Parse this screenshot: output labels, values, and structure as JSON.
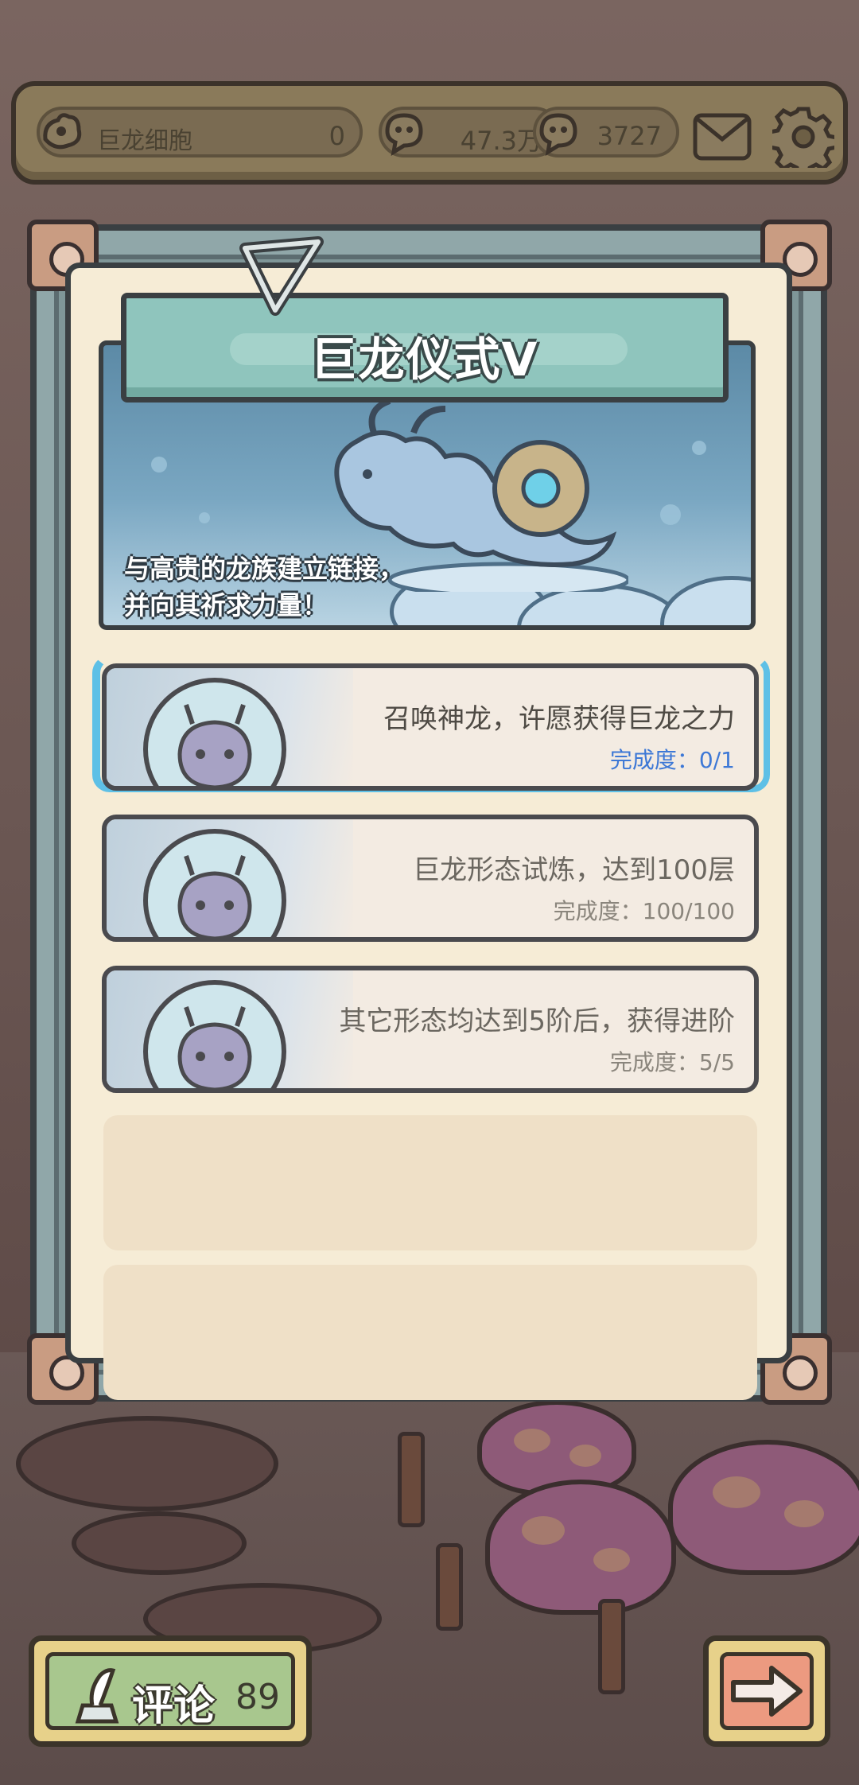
{
  "resources": [
    {
      "icon": "dragon-cell-icon",
      "label": "巨龙细胞",
      "value": "0"
    },
    {
      "icon": "dna-gem-icon",
      "value": "47.3万"
    },
    {
      "icon": "chat-bubble-icon",
      "value": "3727"
    }
  ],
  "top_buttons": {
    "mail_icon": "mail-icon",
    "settings_icon": "gear-icon"
  },
  "panel": {
    "title": "巨龙仪式V",
    "description_line1": "与高贵的龙族建立链接，",
    "description_line2": "并向其祈求力量！"
  },
  "tasks": [
    {
      "name": "召唤神龙，许愿获得巨龙之力",
      "progress": "完成度：0/1",
      "state": "active"
    },
    {
      "name": "巨龙形态试炼，达到100层",
      "progress": "完成度：100/100",
      "state": "done"
    },
    {
      "name": "其它形态均达到5阶后，获得进阶",
      "progress": "完成度：5/5",
      "state": "done"
    }
  ],
  "bottom": {
    "comment_label": "评论",
    "comment_count": "89",
    "next_icon": "arrow-right-icon"
  },
  "colors": {
    "accent_progress": "#3d78d6",
    "water_outline": "#5ec0e6",
    "title_plate": "#8fc5bd",
    "paper": "#f6ecd6"
  }
}
